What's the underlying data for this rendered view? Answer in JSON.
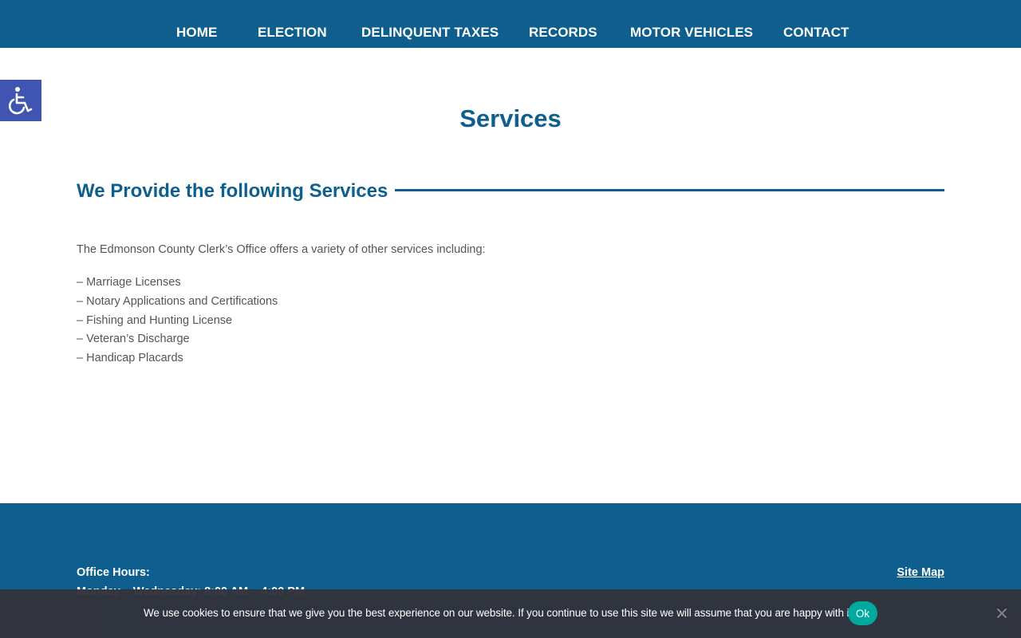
{
  "nav": {
    "items": [
      {
        "label": "HOME"
      },
      {
        "label": "ELECTION"
      },
      {
        "label": "DELINQUENT TAXES"
      },
      {
        "label": "RECORDS"
      },
      {
        "label": "MOTOR VEHICLES"
      },
      {
        "label": "CONTACT"
      }
    ]
  },
  "accessibility": {
    "icon": "wheelchair-icon"
  },
  "page": {
    "title": "Services",
    "section_heading": "We Provide the following Services",
    "intro": "The Edmonson County Clerk’s Office offers a variety of other services including:",
    "services": [
      "– Marriage Licenses",
      "– Notary Applications and Certifications",
      "– Fishing and Hunting License",
      "– Veteran’s Discharge",
      "– Handicap Placards"
    ]
  },
  "footer": {
    "office_hours_label": "Office Hours:",
    "office_hours_value": "Monday – Wednesday: 8:00 AM – 4:00 PM",
    "sitemap_label": "Site Map"
  },
  "cookie": {
    "text": "We use cookies to ensure that we give you the best experience on our website. If you continue to use this site we will assume that you are happy with it.",
    "ok_label": "Ok",
    "close_icon": "close-icon"
  },
  "colors": {
    "brand": "#0e5f8e",
    "accessibility": "#4054b2",
    "cookie_bg": "#32323a",
    "cookie_button": "#00a99d",
    "body_text": "#555555"
  }
}
